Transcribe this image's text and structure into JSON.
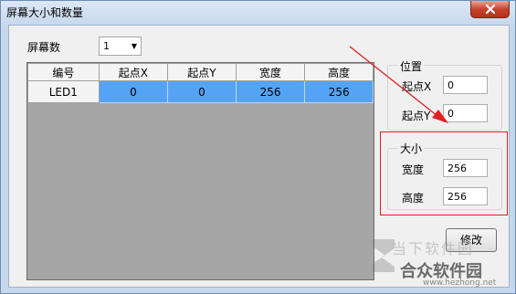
{
  "window": {
    "title": "屏幕大小和数量"
  },
  "screen_count": {
    "label": "屏幕数",
    "value": "1"
  },
  "table": {
    "headers": [
      "编号",
      "起点X",
      "起点Y",
      "宽度",
      "高度"
    ],
    "rows": [
      {
        "id": "LED1",
        "x": "0",
        "y": "0",
        "width": "256",
        "height": "256"
      }
    ]
  },
  "position": {
    "title": "位置",
    "x_label": "起点X",
    "x_value": "0",
    "y_label": "起点Y",
    "y_value": "0"
  },
  "size": {
    "title": "大小",
    "width_label": "宽度",
    "width_value": "256",
    "height_label": "高度",
    "height_value": "256"
  },
  "buttons": {
    "modify": "修改"
  },
  "watermark": {
    "line1": "当下软件园",
    "line2": "合众软件园",
    "url": "www.hezhong.net"
  },
  "colors": {
    "selected_row": "#55a3f5",
    "annotation": "#e02020",
    "close_button": "#c7432a"
  }
}
